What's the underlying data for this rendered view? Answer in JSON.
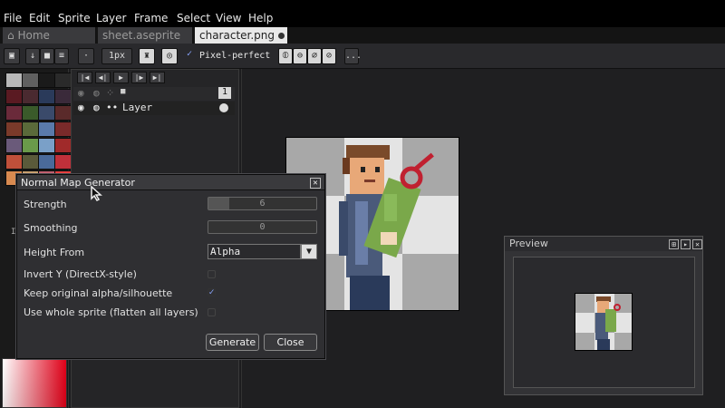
{
  "menu": [
    "File",
    "Edit",
    "Sprite",
    "Layer",
    "Frame",
    "Select",
    "View",
    "Help"
  ],
  "tabs": [
    {
      "label": "Home",
      "icon": "home-icon",
      "active": false
    },
    {
      "label": "sheet.aseprite",
      "active": false
    },
    {
      "label": "character.png",
      "active": true
    }
  ],
  "toolbar": {
    "brush_size": "1px",
    "pixel_perfect_label": "Pixel-perfect",
    "pixel_perfect_checked": true,
    "more_label": "..."
  },
  "timeline": {
    "frame_number": "1",
    "layer_name": "Layer"
  },
  "dialog": {
    "title": "Normal Map Generator",
    "strength_label": "Strength",
    "strength_value": "6",
    "smoothing_label": "Smoothing",
    "smoothing_value": "0",
    "height_from_label": "Height From",
    "height_from_value": "Alpha",
    "invert_y_label": "Invert Y (DirectX-style)",
    "invert_y_checked": false,
    "keep_alpha_label": "Keep original alpha/silhouette",
    "keep_alpha_checked": true,
    "whole_sprite_label": "Use whole sprite (flatten all layers)",
    "whole_sprite_checked": false,
    "generate_label": "Generate",
    "close_label": "Close"
  },
  "preview": {
    "title": "Preview"
  },
  "colors": {
    "menubar_bg": "#000000",
    "panel_bg": "#2f2f32",
    "accent_check": "#8aa6ff",
    "active_tab": "#e8e8e8"
  },
  "palette": [
    "#b8b8b8",
    "#606060",
    "#1a1a1a",
    "#2a2a2a",
    "#5a1a22",
    "#4a2a30",
    "#2a3a5a",
    "#3a2a3a",
    "#6a2a3a",
    "#3a5a2a",
    "#3a4a6a",
    "#5a2a2a",
    "#7a3a2a",
    "#5a6a3a",
    "#5a7aaa",
    "#7a2a2a",
    "#6a5a7a",
    "#6a9a4a",
    "#7aa0c8",
    "#a02a2a",
    "#c0503a",
    "#5a5a3a",
    "#4a6a9a",
    "#c0303a",
    "#d88a50",
    "#c8a070",
    "#c06070",
    "#e84040"
  ]
}
